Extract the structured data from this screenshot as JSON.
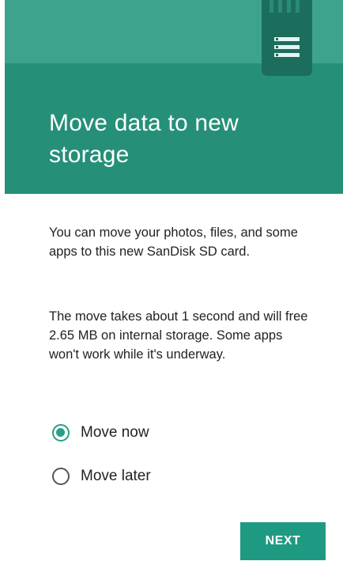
{
  "header": {
    "title": "Move data to new storage",
    "icon": "sd-card-icon"
  },
  "body": {
    "paragraph1": "You can move your photos, files, and some apps to this new SanDisk SD card.",
    "paragraph2": "The move takes about 1 second and will free 2.65 MB on internal storage. Some apps won't work while it's underway."
  },
  "options": {
    "move_now": {
      "label": "Move now",
      "selected": true
    },
    "move_later": {
      "label": "Move later",
      "selected": false
    }
  },
  "actions": {
    "next_label": "NEXT"
  },
  "colors": {
    "accent": "#26a086",
    "header": "#268f78",
    "header_band": "#3da38d",
    "button": "#1f9a82",
    "sd_card": "#1c6e5c"
  }
}
